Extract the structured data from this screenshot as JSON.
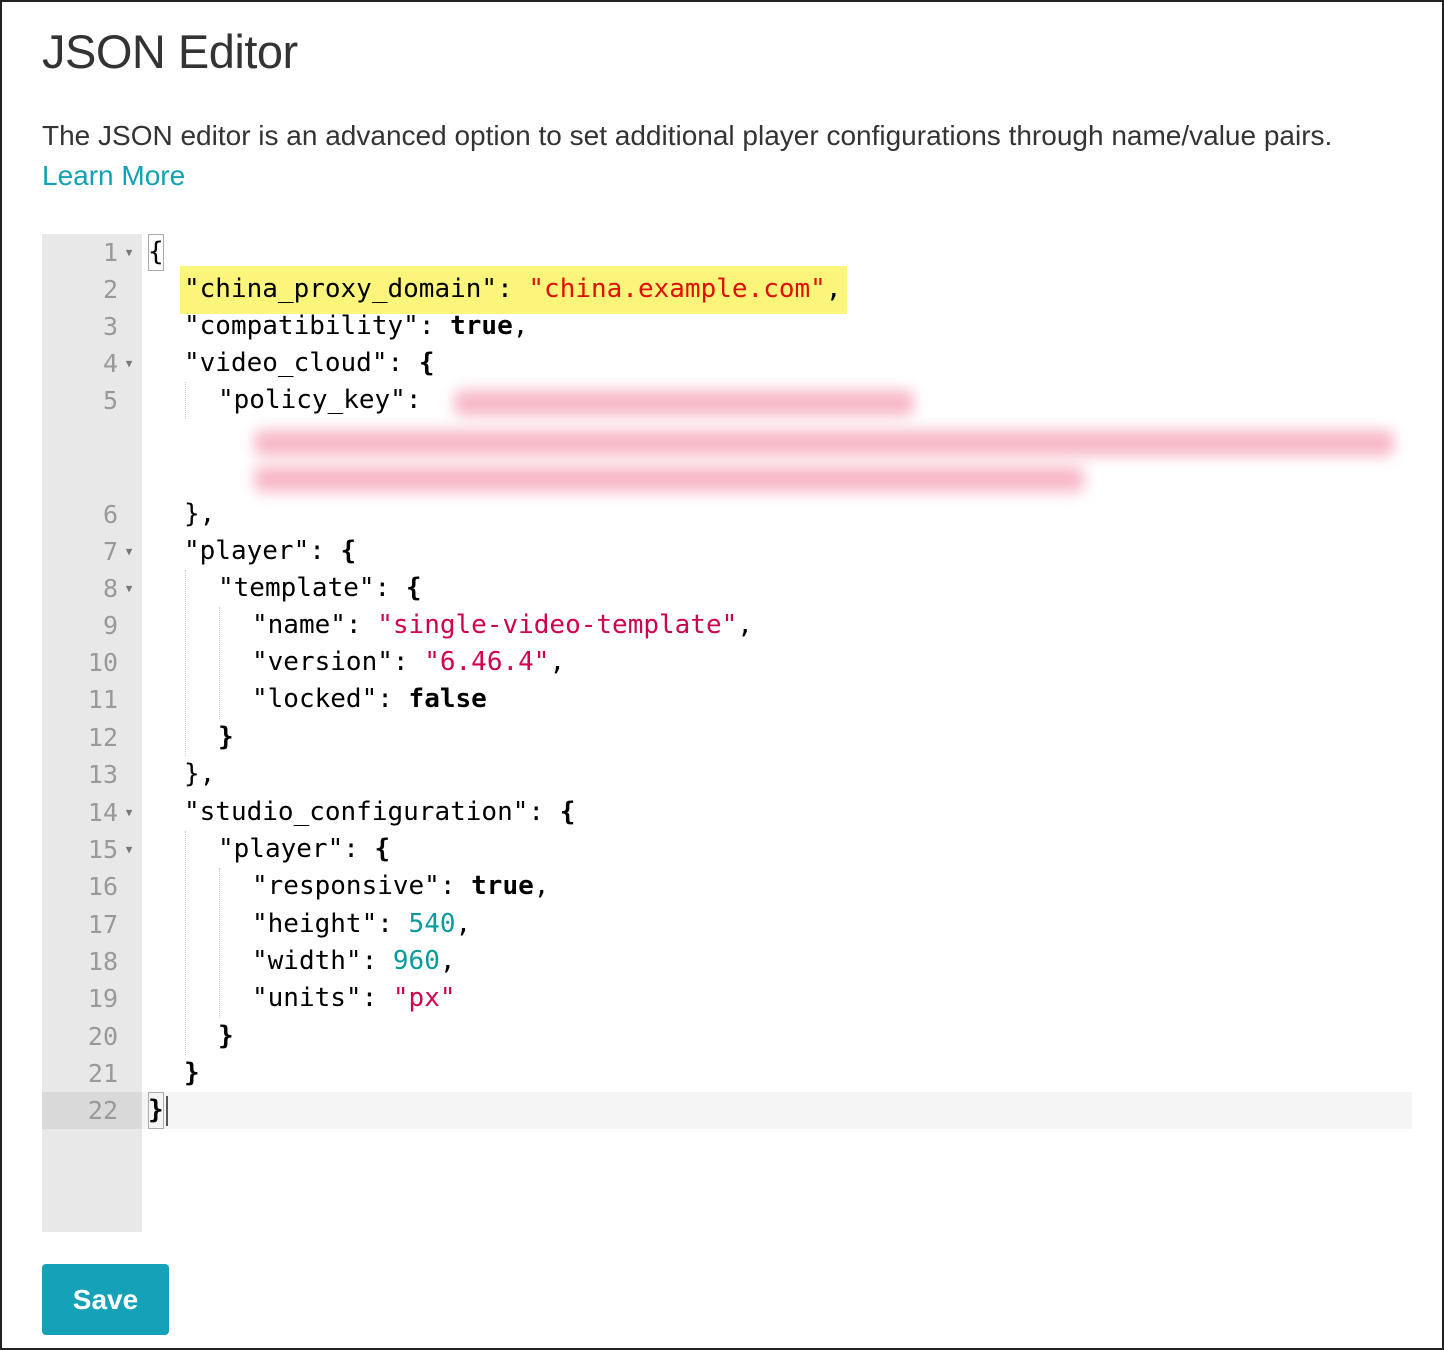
{
  "page": {
    "title": "JSON Editor",
    "description": "The JSON editor is an advanced option to set additional player configurations through name/value pairs.",
    "learn_more": "Learn More"
  },
  "editor": {
    "lines": [
      {
        "num": "1",
        "fold": true,
        "text": "{"
      },
      {
        "num": "2",
        "fold": false,
        "key": "\"china_proxy_domain\"",
        "value": "\"china.example.com\"",
        "highlighted": true
      },
      {
        "num": "3",
        "fold": false,
        "key": "\"compatibility\"",
        "value": "true"
      },
      {
        "num": "4",
        "fold": true,
        "key": "\"video_cloud\"",
        "value": "{"
      },
      {
        "num": "5",
        "fold": false,
        "key": "\"policy_key\"",
        "value_blurred": true
      },
      {
        "num": "6",
        "fold": false,
        "text": "},"
      },
      {
        "num": "7",
        "fold": true,
        "key": "\"player\"",
        "value": "{"
      },
      {
        "num": "8",
        "fold": true,
        "key": "\"template\"",
        "value": "{"
      },
      {
        "num": "9",
        "fold": false,
        "key": "\"name\"",
        "value": "\"single-video-template\""
      },
      {
        "num": "10",
        "fold": false,
        "key": "\"version\"",
        "value": "\"6.46.4\""
      },
      {
        "num": "11",
        "fold": false,
        "key": "\"locked\"",
        "value": "false"
      },
      {
        "num": "12",
        "fold": false,
        "text": "}"
      },
      {
        "num": "13",
        "fold": false,
        "text": "},"
      },
      {
        "num": "14",
        "fold": true,
        "key": "\"studio_configuration\"",
        "value": "{"
      },
      {
        "num": "15",
        "fold": true,
        "key": "\"player\"",
        "value": "{"
      },
      {
        "num": "16",
        "fold": false,
        "key": "\"responsive\"",
        "value": "true"
      },
      {
        "num": "17",
        "fold": false,
        "key": "\"height\"",
        "value": "540"
      },
      {
        "num": "18",
        "fold": false,
        "key": "\"width\"",
        "value": "960"
      },
      {
        "num": "19",
        "fold": false,
        "key": "\"units\"",
        "value": "\"px\""
      },
      {
        "num": "20",
        "fold": false,
        "text": "}"
      },
      {
        "num": "21",
        "fold": false,
        "text": "}"
      },
      {
        "num": "22",
        "fold": false,
        "text": "}",
        "active": true
      }
    ]
  },
  "actions": {
    "save_label": "Save"
  },
  "colors": {
    "accent": "#15a1b7",
    "link": "#13a0b4",
    "string": "#d1004f",
    "number": "#0a9b9b",
    "highlight": "#fbf57c"
  }
}
